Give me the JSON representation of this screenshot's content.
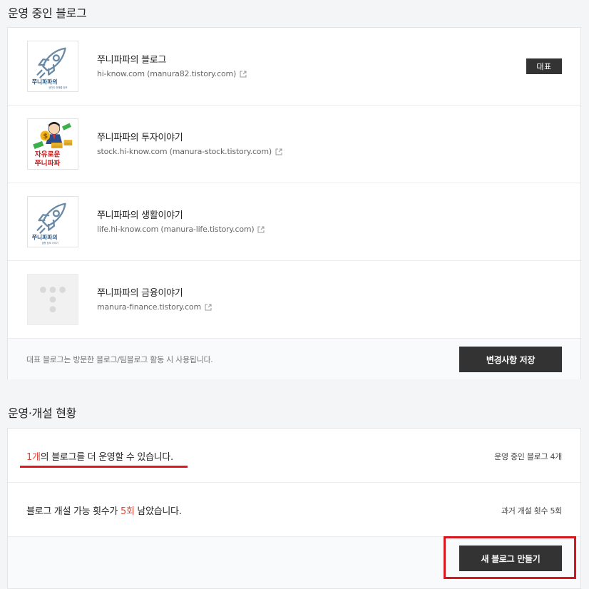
{
  "sections": {
    "active_title": "운영 중인 블로그",
    "status_title": "운영·개설 현황"
  },
  "blogs": [
    {
      "name": "쭈니파파의 블로그",
      "url": "hi-know.com (manura82.tistory.com)",
      "thumb": "rocket-logo",
      "badge": "대표"
    },
    {
      "name": "쭈니파파의 투자이야기",
      "url": "stock.hi-know.com (manura-stock.tistory.com)",
      "thumb": "money-man-logo",
      "thumb_text": [
        "자유로운",
        "쭈니파파"
      ]
    },
    {
      "name": "쭈니파파의 생활이야기",
      "url": "life.hi-know.com (manura-life.tistory.com)",
      "thumb": "rocket-logo"
    },
    {
      "name": "쭈니파파의 금융이야기",
      "url": "manura-finance.tistory.com",
      "thumb": "tistory-default-logo"
    }
  ],
  "footer": {
    "note": "대표 블로그는 방문한 블로그/팀블로그 활동 시 사용됩니다.",
    "save_button": "변경사항 저장"
  },
  "status": {
    "remaining_count": "1개",
    "remaining_text": "의 블로그를 더 운영할 수 있습니다.",
    "active_count_label": "운영 중인 블로그 4개",
    "open_text_prefix": "블로그 개설 가능 횟수가 ",
    "open_count": "5회",
    "open_text_suffix": " 남았습니다.",
    "past_count_label": "과거 개설 횟수 5회",
    "create_button": "새 블로그 만들기"
  },
  "colors": {
    "accent": "#ea4335",
    "button_bg": "#333333",
    "annotation_red": "#d8161e"
  }
}
